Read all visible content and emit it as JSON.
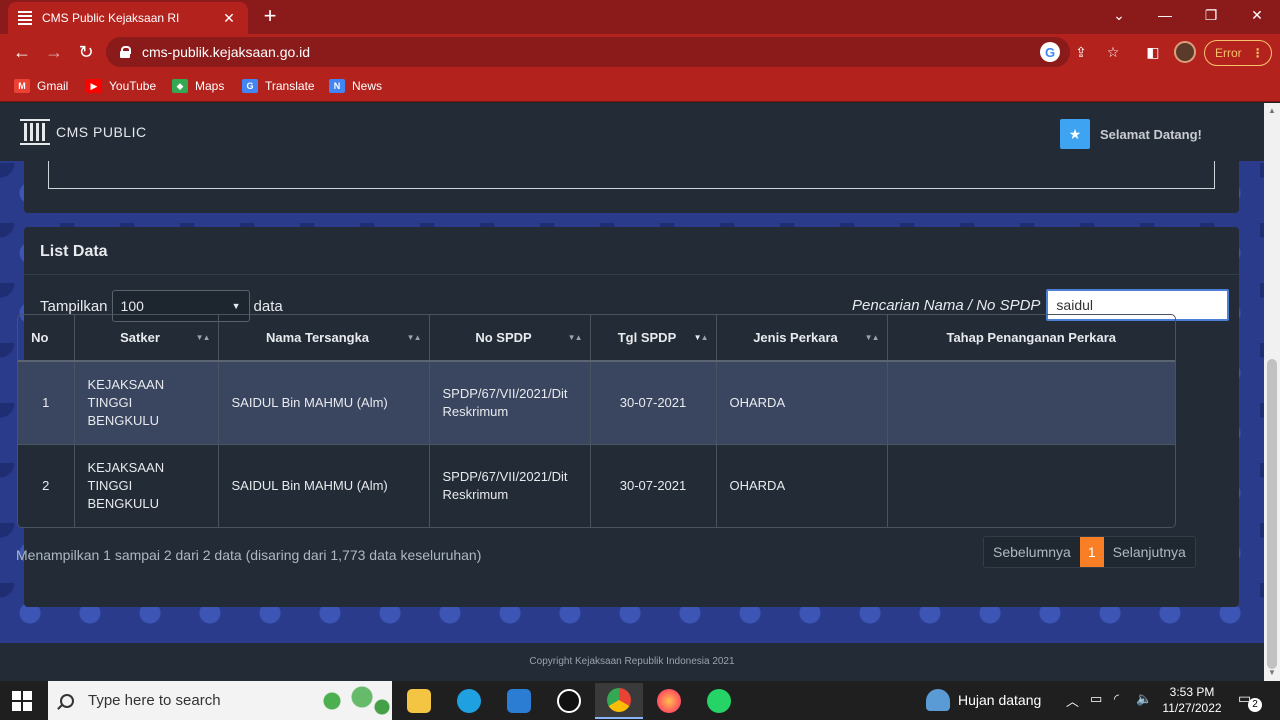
{
  "browser": {
    "tab_title": "CMS Public Kejaksaan RI",
    "url": "cms-publik.kejaksaan.go.id",
    "error_label": "Error",
    "bookmarks": [
      {
        "label": "Gmail",
        "icon": "gmail-icon",
        "color": "#ea4335"
      },
      {
        "label": "YouTube",
        "icon": "youtube-icon",
        "color": "#ff0000"
      },
      {
        "label": "Maps",
        "icon": "maps-icon",
        "color": "#34a853"
      },
      {
        "label": "Translate",
        "icon": "translate-icon",
        "color": "#4285f4"
      },
      {
        "label": "News",
        "icon": "news-icon",
        "color": "#4285f4"
      }
    ]
  },
  "navbar": {
    "brand": "CMS PUBLIC",
    "welcome": "Selamat Datang!"
  },
  "list": {
    "title": "List Data",
    "length_prefix": "Tampilkan",
    "length_value": "100",
    "length_suffix": "data",
    "search_label": "Pencarian Nama / No SPDP",
    "search_value": "saidul",
    "columns": [
      "No",
      "Satker",
      "Nama Tersangka",
      "No SPDP",
      "Tgl SPDP",
      "Jenis Perkara",
      "Tahap Penanganan Perkara"
    ],
    "rows": [
      {
        "no": "1",
        "satker": "KEJAKSAAN TINGGI BENGKULU",
        "nama": "SAIDUL Bin MAHMU (Alm)",
        "spdp": "SPDP/67/VII/2021/Dit Reskrimum",
        "tgl": "30-07-2021",
        "jenis": "OHARDA",
        "tahap": ""
      },
      {
        "no": "2",
        "satker": "KEJAKSAAN TINGGI BENGKULU",
        "nama": "SAIDUL Bin MAHMU (Alm)",
        "spdp": "SPDP/67/VII/2021/Dit Reskrimum",
        "tgl": "30-07-2021",
        "jenis": "OHARDA",
        "tahap": ""
      }
    ],
    "info": "Menampilkan 1 sampai 2 dari 2 data (disaring dari 1,773 data keseluruhan)",
    "pager": {
      "prev": "Sebelumnya",
      "current": "1",
      "next": "Selanjutnya"
    }
  },
  "footer": "Copyright Kejaksaan Republik Indonesia 2021",
  "taskbar": {
    "search_placeholder": "Type here to search",
    "weather": "Hujan datang",
    "time": "3:53 PM",
    "date": "11/27/2022",
    "notifications": "2"
  }
}
